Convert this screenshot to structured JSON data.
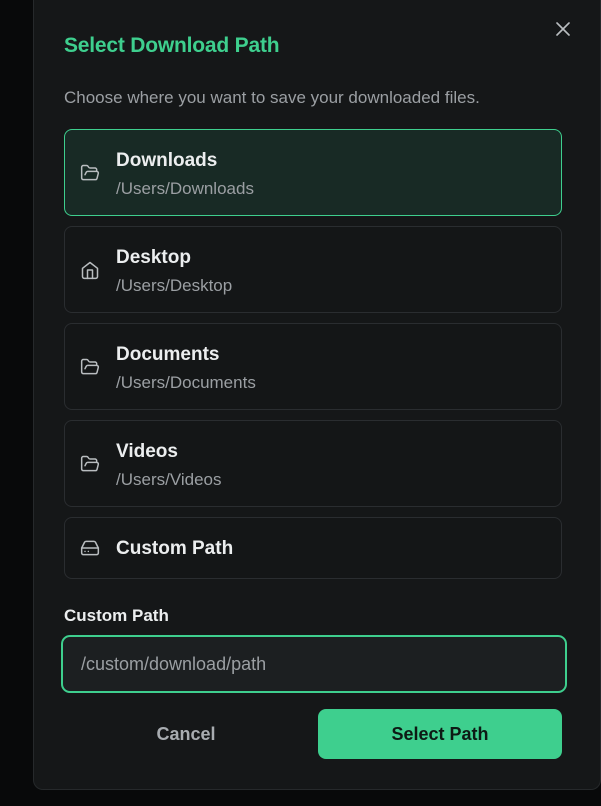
{
  "dialog": {
    "title": "Select Download Path",
    "description": "Choose where you want to save your downloaded files."
  },
  "options": [
    {
      "name": "Downloads",
      "path": "/Users/Downloads",
      "icon": "folder-open-icon",
      "selected": true
    },
    {
      "name": "Desktop",
      "path": "/Users/Desktop",
      "icon": "home-icon",
      "selected": false
    },
    {
      "name": "Documents",
      "path": "/Users/Documents",
      "icon": "folder-open-icon",
      "selected": false
    },
    {
      "name": "Videos",
      "path": "/Users/Videos",
      "icon": "folder-open-icon",
      "selected": false
    },
    {
      "name": "Custom Path",
      "path": "",
      "icon": "hard-drive-icon",
      "selected": false
    }
  ],
  "custom_path": {
    "label": "Custom Path",
    "value": "/custom/download/path"
  },
  "buttons": {
    "cancel": "Cancel",
    "select": "Select Path"
  },
  "colors": {
    "accent": "#3ecf8e",
    "background": "#151718",
    "selected_bg": "#182a25"
  }
}
